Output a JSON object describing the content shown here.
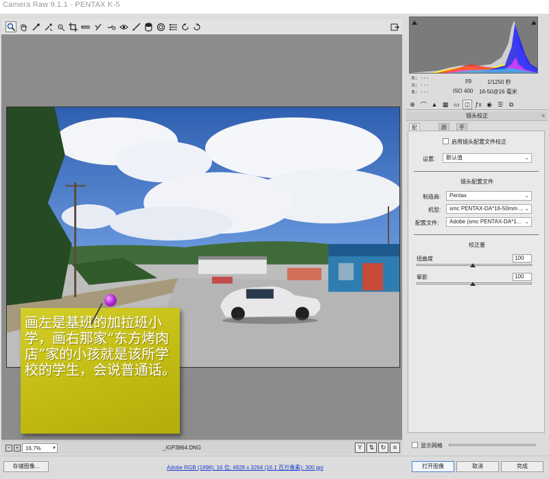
{
  "window": {
    "title": "Camera Raw 9.1.1 - PENTAX K-5"
  },
  "toolbar": {
    "tools": [
      "zoom-tool",
      "hand-tool",
      "white-balance-tool",
      "color-sampler-tool",
      "targeted-adjustment-tool",
      "crop-tool",
      "straighten-tool",
      "transform-tool",
      "spot-removal-tool",
      "red-eye-removal-tool",
      "adjustment-brush-tool",
      "graduated-filter-tool",
      "radial-filter-tool",
      "preferences-tool",
      "rotate-ccw-tool",
      "rotate-cw-tool"
    ],
    "active_tool": "zoom-tool"
  },
  "annotation": {
    "text": "画左是基班的加拉班小学，画右那家“东方烤肉店”家的小孩就是该所学校的学生，会说普通话。",
    "color": "#c9c21a",
    "pin_color": "#b82ddd"
  },
  "bottom_bar": {
    "zoom_value": "16.7%",
    "filename": "_IGP3864.DNG"
  },
  "histogram": {
    "r": "R:",
    "g": "G:",
    "b": "B:",
    "r_val": "---",
    "g_val": "---",
    "b_val": "---",
    "aperture": "f/9",
    "shutter": "1/1250 秒",
    "iso": "ISO 400",
    "lens": "16-50@16 毫米"
  },
  "panel": {
    "title": "镜头校正",
    "subtabs": [
      "配置文件",
      "颜色",
      "手动"
    ],
    "active_subtab": "配置文件",
    "enable_profile_label": "启用镜头配置文件校正",
    "enable_profile_checked": false,
    "setup_label": "设置:",
    "setup_value": "默认值",
    "profile_section_title": "镜头配置文件",
    "make_label": "制造商:",
    "make_value": "Pentax",
    "model_label": "机型:",
    "model_value": "smc PENTAX-DA*16-50mm ...",
    "profile_label": "配置文件:",
    "profile_value": "Adobe (smc PENTAX-DA*1...",
    "correction_section_title": "校正量",
    "distortion_label": "扭曲度",
    "distortion_value": "100",
    "vignetting_label": "晕影",
    "vignetting_value": "100"
  },
  "grid": {
    "label": "显示网格",
    "checked": false
  },
  "footer": {
    "save_label": "存储图像...",
    "workflow_text": "Adobe RGB (1998); 16 位; 4928 x 3264 (16.1 百万像素); 300 ppi",
    "open_label": "打开图像",
    "cancel_label": "取消",
    "done_label": "完成"
  }
}
